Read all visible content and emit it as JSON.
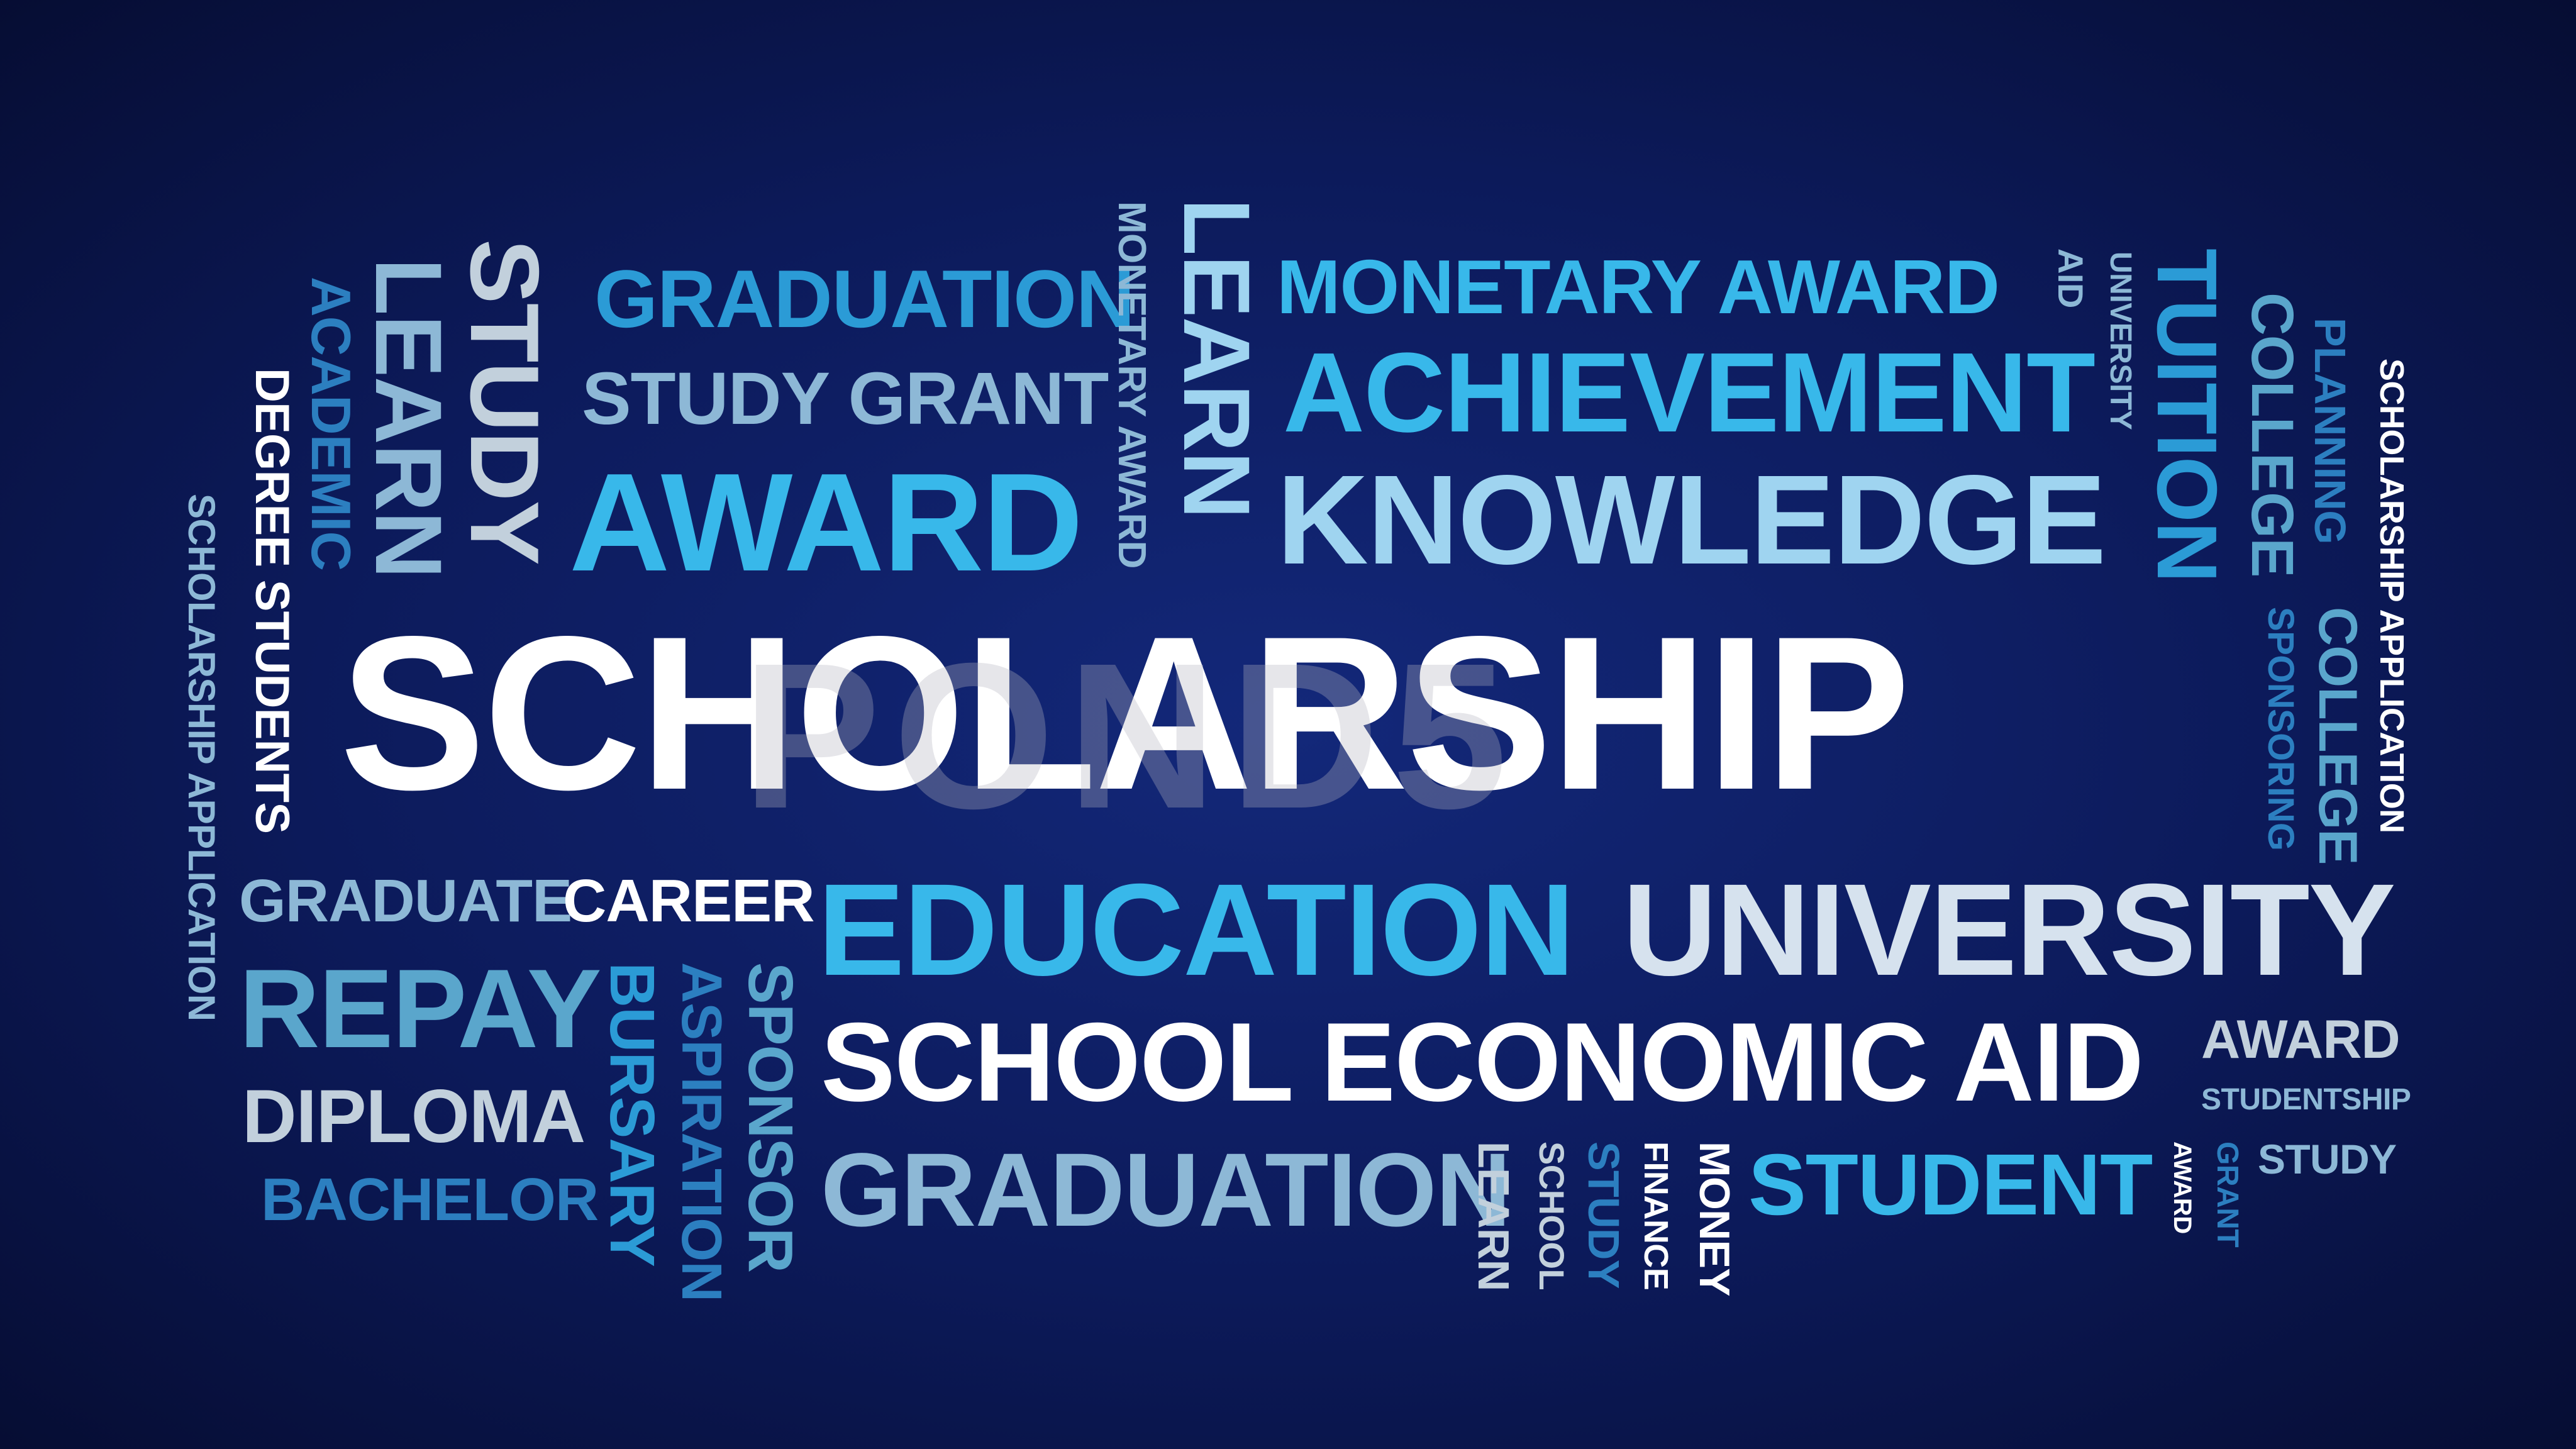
{
  "watermark": "POND5",
  "words": {
    "scholarship": "SCHOLARSHIP",
    "graduation_top": "GRADUATION",
    "study_grant": "STUDY GRANT",
    "award_large": "AWARD",
    "monetary_award_h": "MONETARY AWARD",
    "achievement": "ACHIEVEMENT",
    "knowledge": "KNOWLEDGE",
    "education": "EDUCATION",
    "university_large": "UNIVERSITY",
    "school_economic_aid": "SCHOOL ECONOMIC AID",
    "graduation_bottom": "GRADUATION",
    "student": "STUDENT",
    "graduate": "GRADUATE",
    "career": "CAREER",
    "repay": "REPAY",
    "diploma": "DIPLOMA",
    "bachelor": "BACHELOR",
    "award_small": "AWARD",
    "studentship": "STUDENTSHIP",
    "study_small": "STUDY",
    "v_study": "STUDY",
    "v_learn_left": "LEARN",
    "v_academic": "ACADEMIC",
    "v_degree_students": "DEGREE STUDENTS",
    "v_scholarship_application_left": "SCHOLARSHIP APPLICATION",
    "v_monetary_award": "MONETARY AWARD",
    "v_learn_center": "LEARN",
    "v_aid": "AID",
    "v_university_small": "UNIVERSITY",
    "v_tuition": "TUITION",
    "v_college_1": "COLLEGE",
    "v_planning": "PLANNING",
    "v_scholarship_application_right": "SCHOLARSHIP APPLICATION",
    "v_sponsoring": "SPONSORING",
    "v_college_2": "COLLEGE",
    "v_bursary": "BURSARY",
    "v_aspiration": "ASPIRATION",
    "v_sponsor": "SPONSOR",
    "v_learn_bottom": "LEARN",
    "v_school": "SCHOOL",
    "v_study_bottom": "STUDY",
    "v_finance": "FINANCE",
    "v_money": "MONEY",
    "v_award_bottom": "AWARD",
    "v_grant": "GRANT"
  }
}
